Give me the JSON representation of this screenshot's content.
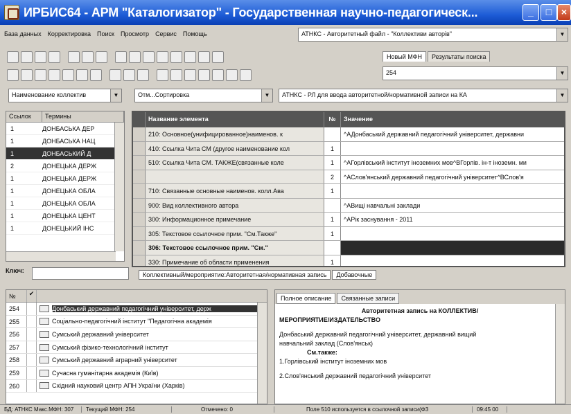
{
  "window": {
    "title": "ИРБИС64 - АРМ \"Каталогизатор\" - Государственная научно-педагогическ...",
    "min_label": "_",
    "max_label": "□",
    "close_label": "×"
  },
  "menu": [
    "База данных",
    "Корректировка",
    "Поиск",
    "Просмотр",
    "Сервис",
    "Помощь"
  ],
  "db_combo": "АТНКС - Авторитетный файл - \"Коллективи авторів\"",
  "right_tabs": [
    "Новый МФН",
    "Результаты поиска"
  ],
  "right_tab_field": "254",
  "field_combos": {
    "left": "Наименование коллектив",
    "mid": "Отм...Сортировка",
    "right": "АТНКС - РЛ для ввода авторитетной/нормативной записи на КА"
  },
  "left_list": {
    "headers": [
      "Ссылок",
      "Термины"
    ],
    "rows": [
      {
        "ref": "1",
        "term": "ДОНБАСЬКА ДЕР"
      },
      {
        "ref": "1",
        "term": "ДОНБАСЬКА НАЦ"
      },
      {
        "ref": "1",
        "term": "ДОНБАСЬКИЙ Д",
        "selected": true
      },
      {
        "ref": "2",
        "term": "ДОНЕЦЬКА ДЕРЖ"
      },
      {
        "ref": "1",
        "term": "ДОНЕЦЬКА ДЕРЖ"
      },
      {
        "ref": "1",
        "term": "ДОНЕЦЬКА ОБЛА"
      },
      {
        "ref": "1",
        "term": "ДОНЕЦЬКА ОБЛА"
      },
      {
        "ref": "1",
        "term": "ДОНЕЦЬКА ЦЕНТ"
      },
      {
        "ref": "1",
        "term": "ДОНЕЦЬКИЙ ІНС"
      }
    ]
  },
  "key_label": "Ключ:",
  "grid": {
    "headers": [
      "Название элемента",
      "№",
      "Значение"
    ],
    "rows": [
      {
        "name": "210: Основное(унифицированное)наименов. к",
        "num": "",
        "value": "^АДонбаський державний педагогічний університет, державни"
      },
      {
        "name": "410: Ссылка Чита СМ (другое наименование кол",
        "num": "1",
        "value": ""
      },
      {
        "name": "510: Ссылка Чита СМ. ТАКЖЕ(связанные коле",
        "num": "1",
        "value": "^АГорлівський інститут іноземних мов^ВГорлів. ін-т іноземн. ми"
      },
      {
        "name": "",
        "num": "2",
        "value": "^АСлов'янський державний педагогічний університет^ВСлов'я"
      },
      {
        "name": "710: Связанные основные наименов. колл.Ава",
        "num": "1",
        "value": ""
      },
      {
        "name": "900: Вид коллективного автора",
        "num": "",
        "value": "^АВищі навчальні заклади"
      },
      {
        "name": "300: Информационное примечание",
        "num": "1",
        "value": "^АРік заснування - 2011"
      },
      {
        "name": "305: Текстовое ссылочное прим. \"См.Также\"",
        "num": "1",
        "value": ""
      },
      {
        "name": "306: Текстовое ссылочное прим. \"См.\"",
        "num": "",
        "value": "",
        "bold": true,
        "dark": true
      },
      {
        "name": "330: Примечание об области применения",
        "num": "1",
        "value": ""
      }
    ]
  },
  "bottom_tabs": [
    "Коллективный/мероприятие:Авторитетная/нормативная запись",
    "Добавочные"
  ],
  "bottom_list": {
    "headers": [
      "№"
    ],
    "rows": [
      {
        "n": "254",
        "text": "Донбаський державний педагогічний університет, держ",
        "selected": true
      },
      {
        "n": "255",
        "text": "Соціально-педагогічний інститут \"Педагогічна академія"
      },
      {
        "n": "256",
        "text": "Сумський державний університет"
      },
      {
        "n": "257",
        "text": "Сумський фізико-технологічний інститут"
      },
      {
        "n": "258",
        "text": "Сумський державний аграрний університет"
      },
      {
        "n": "259",
        "text": "Сучасна гуманітарна академія (Київ)"
      },
      {
        "n": "260",
        "text": "Східний науковий центр АПН України (Харків)"
      }
    ]
  },
  "right_panel": {
    "tabs": [
      "Полное описание",
      "Связанные записи"
    ],
    "heading": "Авторитетная запись на КОЛЛЕКТИВ/",
    "heading2": "МЕРОПРИЯТИЕ/ИЗДАТЕЛЬСТВО",
    "line1": "Донбаський державний педагогічний університет, державний вищий",
    "line2": "навчальний заклад (Слов'янськ)",
    "see_label": "См.также:",
    "line3": "1.Горлівський інститут іноземних мов",
    "line4": "2.Слов'янський державний педагогічний університет"
  },
  "status": [
    "БД: АТНКС Макс.МФН: 307",
    "Текущий МФН: 254",
    "Отмечено: 0",
    "Поле 510 используется в ссылочной записи(Ф3",
    "09:45 00"
  ]
}
